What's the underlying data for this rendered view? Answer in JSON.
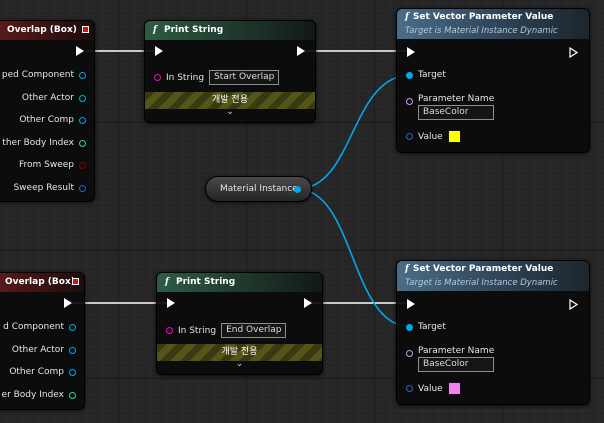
{
  "begin_overlap": {
    "title": "Overlap (Box)",
    "pins": [
      "ped Component",
      "Other Actor",
      "Other Comp",
      "ther Body Index",
      "From Sweep",
      "Sweep Result"
    ]
  },
  "end_overlap": {
    "title": "Overlap (Box)",
    "pins": [
      "d Component",
      "Other Actor",
      "Other Comp",
      "er Body Index"
    ]
  },
  "print_string_1": {
    "title": "Print String",
    "in_string_label": "In String",
    "in_string_value": "Start Overlap",
    "dev_only": "개발 전용",
    "expand": "⌄"
  },
  "print_string_2": {
    "title": "Print String",
    "in_string_label": "In String",
    "in_string_value": "End Overlap",
    "dev_only": "개발 전용",
    "expand": "⌄"
  },
  "set_vector_1": {
    "title": "Set Vector Parameter Value",
    "subtitle": "Target is Material Instance Dynamic",
    "target_label": "Target",
    "param_label": "Parameter Name",
    "param_value": "BaseColor",
    "value_label": "Value",
    "value_color": "#ffff00"
  },
  "set_vector_2": {
    "title": "Set Vector Parameter Value",
    "subtitle": "Target is Material Instance Dynamic",
    "target_label": "Target",
    "param_label": "Parameter Name",
    "param_value": "BaseColor",
    "value_label": "Value",
    "value_color": "#ee82ee"
  },
  "variable": {
    "label": "Material Instance"
  },
  "colors": {
    "object_pin": "#00a8f0",
    "struct_pin": "#3060c0",
    "int_pin": "#1fe0a0",
    "bool_pin": "#8c0000",
    "string_pin": "#ff00d4",
    "name_pin": "#cc99ff"
  }
}
